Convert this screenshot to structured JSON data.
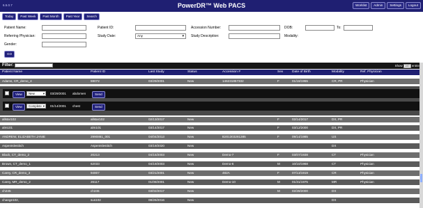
{
  "app": {
    "version": "6.5.0.7",
    "title": "PowerDR™ Web PACS",
    "nav": [
      "Worklist",
      "Admin",
      "Settings",
      "Logout"
    ]
  },
  "quick_buttons": [
    "Today",
    "Past Week",
    "Past Month",
    "Past Year",
    "Search"
  ],
  "form": {
    "patient_name": "Patient Name:",
    "patient_id": "Patient ID:",
    "accession": "Accession Number:",
    "dob": "DOB:",
    "to": "To:",
    "referring": "Referring Physician:",
    "study_date": "Study Date:",
    "study_date_value": "Any",
    "study_desc": "Study Description:",
    "modality": "Modality:",
    "gender": "Gender:",
    "go": "GO"
  },
  "filter": {
    "label": "Filter:",
    "show_prefix": "Show",
    "show_value": "100",
    "show_suffix": "entries"
  },
  "columns": [
    "Patient Name",
    "Patient ID",
    "Last Study",
    "Status",
    "Accession #",
    "Sex",
    "Date of Birth",
    "Modality",
    "Ref. Physician"
  ],
  "rows": [
    [
      "Adams, CR_demo_4",
      "59072",
      "03/29/2001",
      "New",
      "146231857332",
      "F",
      "01/18/1955",
      "CR, PR",
      "Physician"
    ],
    [
      "allstar102",
      "allstar102",
      "02/13/2017",
      "New",
      "",
      "F",
      "02/14/2017",
      "DX, PR",
      ""
    ],
    [
      "alm101",
      "alm101",
      "03/14/2017",
      "New",
      "",
      "F",
      "03/12/2000",
      "DX, PR",
      ""
    ],
    [
      "ANDREW, ELIZABETH JANIE",
      "2990861_001",
      "04/04/2013",
      "New",
      "B201303281385",
      "F",
      "09/14/1985",
      "US",
      ""
    ],
    [
      "AspenIslestitch",
      "AspenIslestitch",
      "03/19/2020",
      "New",
      "",
      "",
      "",
      "DX",
      ""
    ],
    [
      "Black, CT_demo_2",
      "20213",
      "04/15/2003",
      "New",
      "Demo-7",
      "F",
      "03/07/1938",
      "CT",
      "Physician"
    ],
    [
      "Brown, CT_demo_1",
      "62033",
      "04/19/2003",
      "New",
      "Demo-6",
      "M",
      "10/10/1968",
      "CT",
      "Physician"
    ],
    [
      "Carey, CR_demo_3",
      "94807",
      "03/21/2001",
      "New",
      "482A",
      "F",
      "07/13/1919",
      "CR",
      "Physician"
    ],
    [
      "Carey, MR_demo_2",
      "26117",
      "01/08/2001",
      "New",
      "Demo-10",
      "M",
      "01/31/1975",
      "MR",
      "Physician"
    ],
    [
      "ch245",
      "ch245",
      "03/02/2017",
      "New",
      "",
      "M",
      "02/28/2000",
      "DX",
      ""
    ],
    [
      "change102,",
      "sus102",
      "08/26/2016",
      "New",
      "",
      "",
      "",
      "DX",
      ""
    ]
  ],
  "expanded_studies": [
    {
      "status": "New",
      "date": "03/29/2001",
      "desc": "abdomen",
      "view": "View",
      "send": "Send"
    },
    {
      "status": "Complete",
      "date": "01/14/2001",
      "desc": "chest",
      "view": "View",
      "send": "Send"
    }
  ]
}
